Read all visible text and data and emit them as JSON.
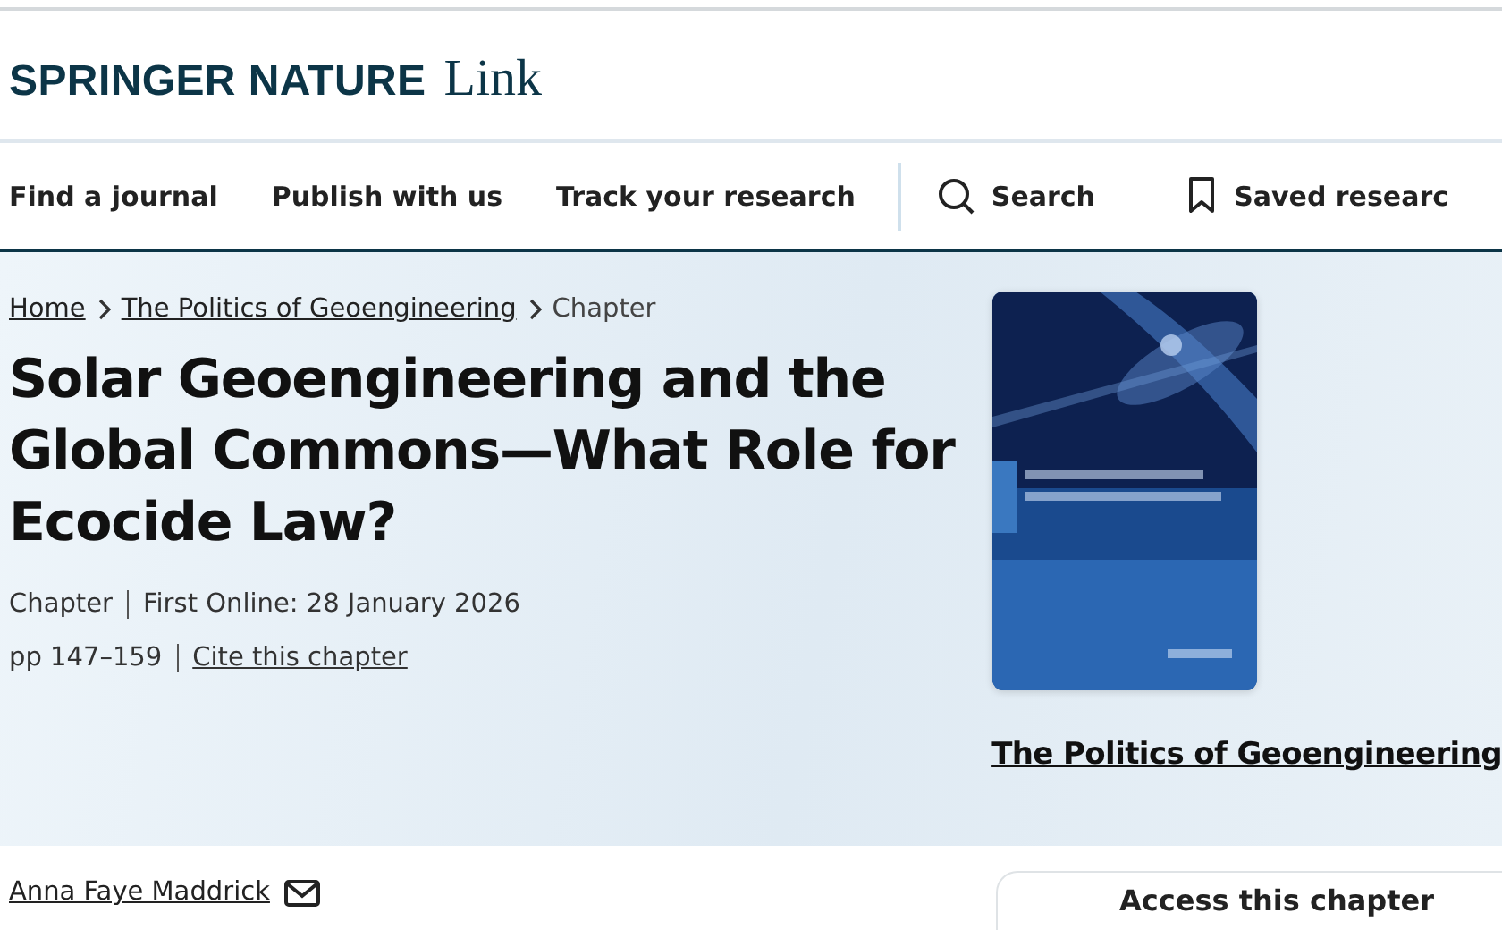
{
  "header": {
    "logo_brand": "SPRINGER NATURE",
    "logo_product": "Link"
  },
  "nav": {
    "items": [
      "Find a journal",
      "Publish with us",
      "Track your research"
    ],
    "search": "Search",
    "saved": "Saved researc"
  },
  "breadcrumb": [
    {
      "label": "Home",
      "link": true
    },
    {
      "label": "The Politics of Geoengineering",
      "link": true
    },
    {
      "label": "Chapter",
      "link": false
    }
  ],
  "title": "Solar Geoengineering and the Global Commons—What Role for Ecocide Law?",
  "meta": {
    "type": "Chapter",
    "first_online": "First Online: 28 January 2026",
    "pages": "pp 147–159",
    "cite": "Cite this chapter"
  },
  "book": {
    "title": "The Politics of Geoengineering"
  },
  "author": "Anna Faye Maddrick",
  "access": {
    "title": "Access this chapter"
  }
}
